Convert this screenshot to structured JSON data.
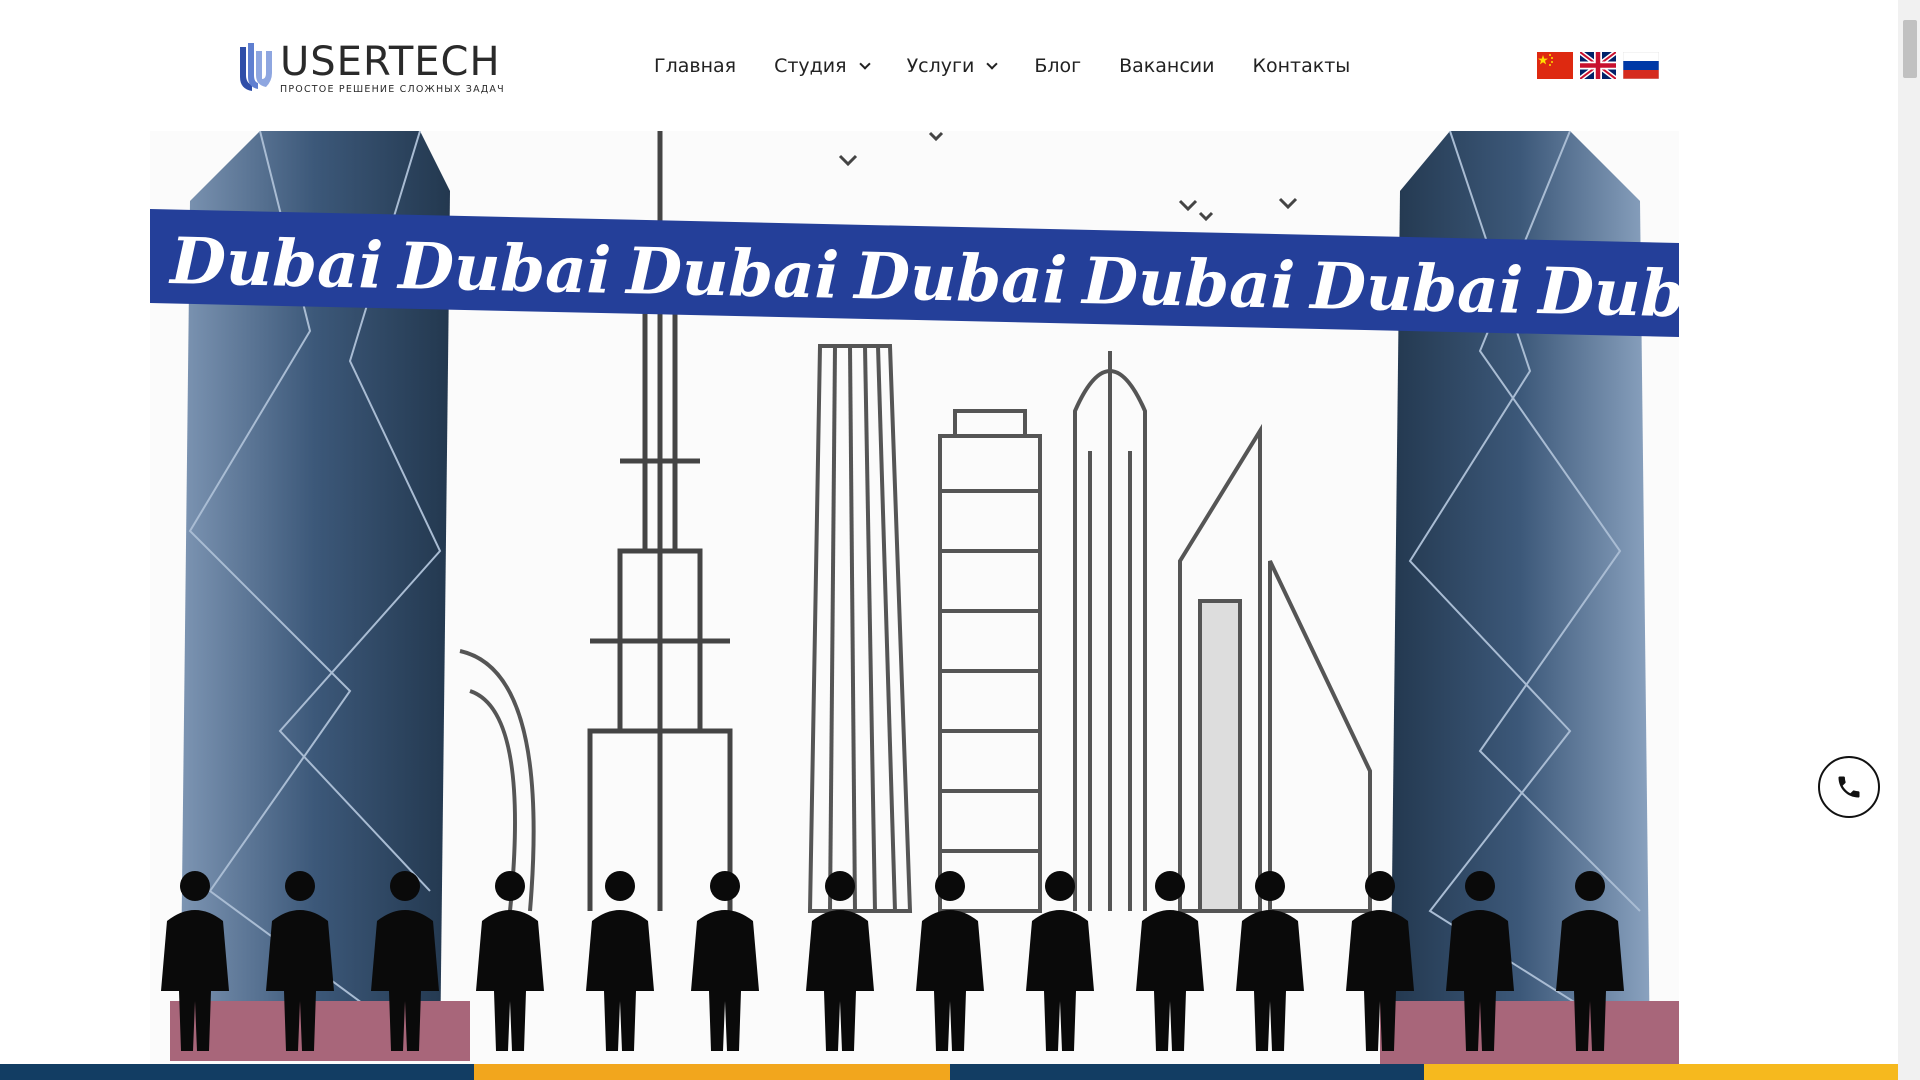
{
  "header": {
    "logo": {
      "name": "USERTECH",
      "tagline": "ПРОСТОЕ РЕШЕНИЕ СЛОЖНЫХ ЗАДАЧ"
    },
    "nav": [
      {
        "label": "Главная",
        "has_dropdown": false
      },
      {
        "label": "Студия",
        "has_dropdown": true
      },
      {
        "label": "Услуги",
        "has_dropdown": true
      },
      {
        "label": "Блог",
        "has_dropdown": false
      },
      {
        "label": "Вакансии",
        "has_dropdown": false
      },
      {
        "label": "Контакты",
        "has_dropdown": false
      }
    ],
    "languages": [
      "china-flag-icon",
      "uk-flag-icon",
      "russia-flag-icon"
    ]
  },
  "hero": {
    "banner_word": "Dubai",
    "banner_color": "#243f99"
  },
  "call_button": {
    "icon": "phone-icon"
  },
  "colors": {
    "brand_blue": "#243f99",
    "strip_dark": "#123d63",
    "strip_orange": "#f2a61d",
    "strip_yellow": "#f6b91e"
  }
}
